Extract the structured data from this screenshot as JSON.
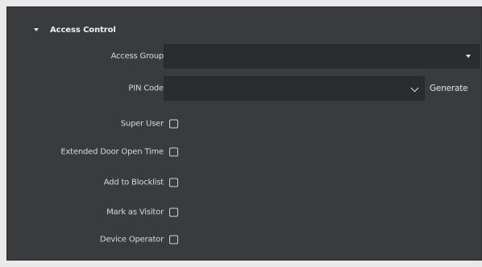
{
  "section": {
    "title": "Access Control"
  },
  "fields": {
    "access_group": {
      "label": "Access Group",
      "value": ""
    },
    "pin_code": {
      "label": "PIN Code",
      "value": "",
      "generate_label": "Generate"
    }
  },
  "checkboxes": [
    {
      "label": "Super User",
      "checked": false
    },
    {
      "label": "Extended Door Open Time",
      "checked": false
    },
    {
      "label": "Add to Blocklist",
      "checked": false
    },
    {
      "label": "Mark as Visitor",
      "checked": false
    },
    {
      "label": "Device Operator",
      "checked": false
    }
  ],
  "colors": {
    "panel_bg": "#393b3e",
    "input_bg": "#2a2c2f",
    "text": "#d9d9d9"
  }
}
